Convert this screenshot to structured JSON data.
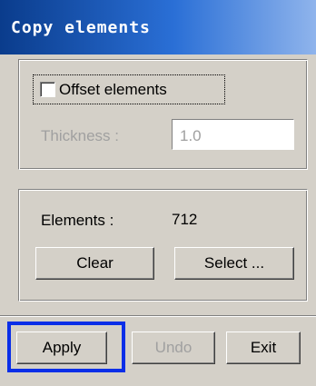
{
  "window": {
    "title": "Copy elements"
  },
  "offset": {
    "checkbox_label": "Offset elements",
    "checked": false
  },
  "thickness": {
    "label": "Thickness :",
    "value": "1.0",
    "enabled": false
  },
  "elements": {
    "label": "Elements :",
    "count": "712"
  },
  "buttons": {
    "clear": "Clear",
    "select": "Select ...",
    "apply": "Apply",
    "undo": "Undo",
    "exit": "Exit"
  },
  "highlight": {
    "target": "apply-button",
    "color": "#0a2ee8"
  }
}
